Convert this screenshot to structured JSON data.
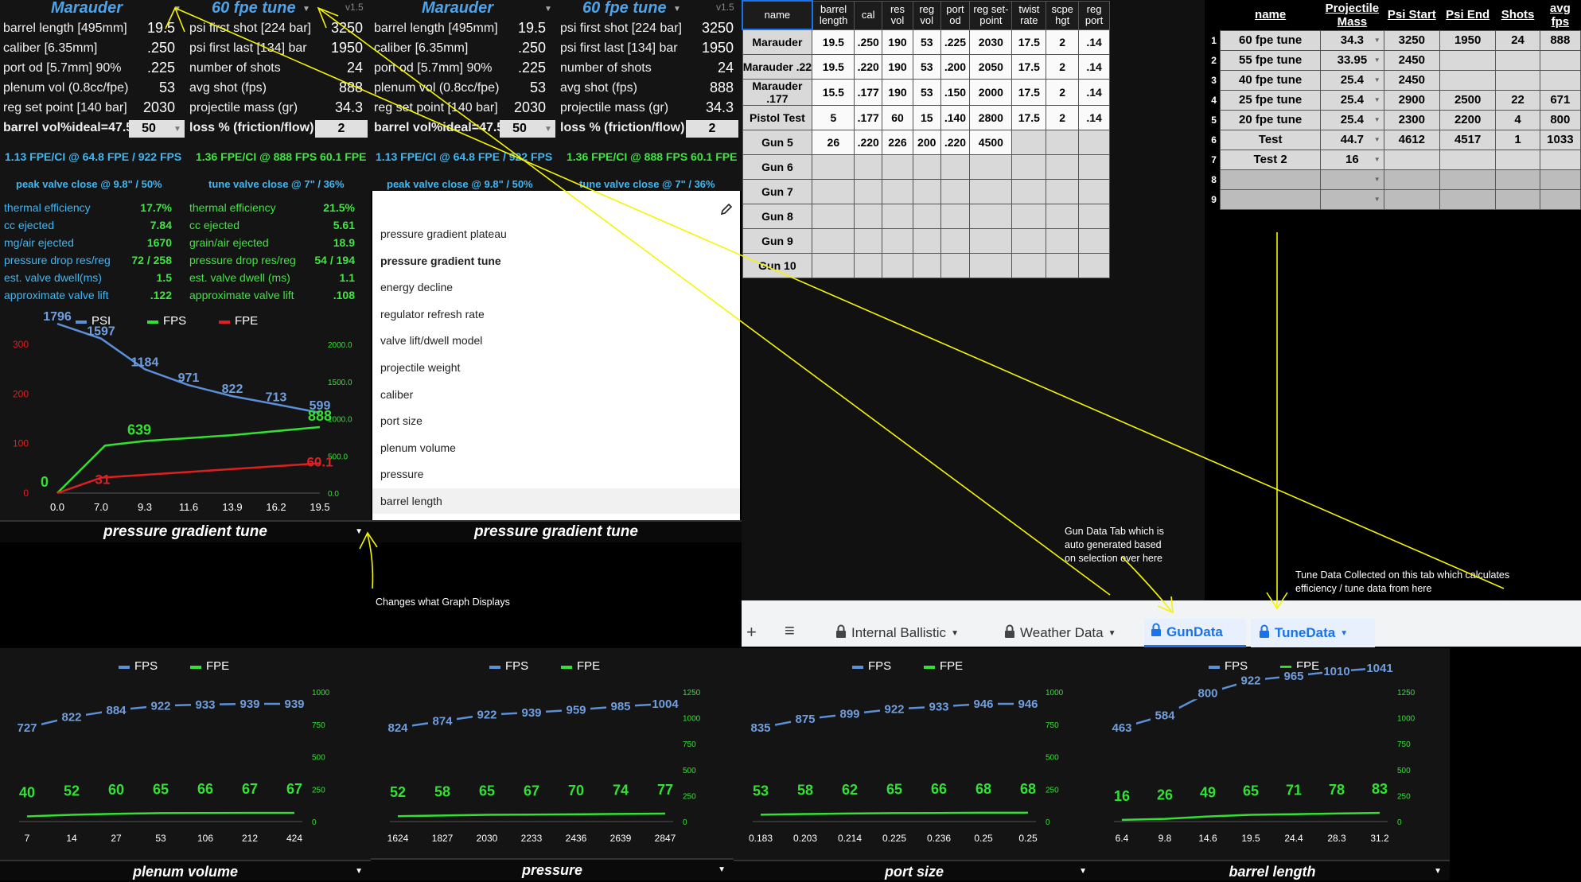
{
  "panels": [
    {
      "name": "Marauder",
      "tune": "60 fpe tune",
      "version": "v1.5",
      "left_labels": [
        "barrel length [495mm]",
        "caliber [6.35mm]",
        "port od [5.7mm] 90%",
        "plenum vol (0.8cc/fpe)",
        "reg set point [140 bar]",
        "barrel vol%ideal=47.5"
      ],
      "left_values": [
        "19.5",
        ".250",
        ".225",
        "53",
        "2030",
        "50"
      ],
      "right_labels": [
        "psi first shot [224 bar]",
        "psi first last [134] bar",
        "number of shots",
        "avg shot (fps)",
        "projectile mass (gr)",
        "loss % (friction/flow)"
      ],
      "right_values": [
        "3250",
        "1950",
        "24",
        "888",
        "34.3",
        "2"
      ],
      "summary_a": "1.13 FPE/CI @ 64.8 FPE / 922 FPS",
      "summary_b": "1.36 FPE/CI @ 888 FPS 60.1 FPE",
      "valve_a": "peak valve close @ 9.8\" / 50%",
      "valve_b": "tune valve close @ 7\" / 36%",
      "footer": "pressure gradient tune"
    },
    {
      "name": "Marauder",
      "tune": "60 fpe tune",
      "version": "v1.5",
      "left_labels": [
        "barrel length [495mm]",
        "caliber [6.35mm]",
        "port od [5.7mm] 90%",
        "plenum vol (0.8cc/fpe)",
        "reg set point [140 bar]",
        "barrel vol%ideal=47.5"
      ],
      "left_values": [
        "19.5",
        ".250",
        ".225",
        "53",
        "2030",
        "50"
      ],
      "right_labels": [
        "psi first shot [224 bar]",
        "psi first last [134] bar",
        "number of shots",
        "avg shot (fps)",
        "projectile mass (gr)",
        "loss % (friction/flow)"
      ],
      "right_values": [
        "3250",
        "1950",
        "24",
        "888",
        "34.3",
        "2"
      ],
      "summary_a": "1.13 FPE/CI @ 64.8 FPE / 922 FPS",
      "summary_b": "1.36 FPE/CI @ 888 FPS 60.1 FPE",
      "valve_a": "peak valve close @ 9.8\" / 50%",
      "valve_b": "tune valve close @ 7\" / 36%",
      "footer": "pressure gradient tune"
    }
  ],
  "stats": {
    "left_labels": [
      "thermal efficiency",
      "cc ejected",
      "mg/air ejected",
      "pressure drop res/reg",
      "est. valve dwell(ms)",
      "approximate valve lift"
    ],
    "left_values": [
      "17.7%",
      "7.84",
      "1670",
      "72 / 258",
      "1.5",
      ".122"
    ],
    "right_labels": [
      "thermal efficiency",
      "cc ejected",
      "grain/air ejected",
      "pressure drop res/reg",
      "est. valve dwell (ms)",
      "approximate valve lift"
    ],
    "right_values": [
      "21.5%",
      "5.61",
      "18.9",
      "54 / 194",
      "1.1",
      ".108"
    ]
  },
  "menu_items": [
    "pressure gradient plateau",
    "pressure gradient tune",
    "energy decline",
    "regulator refresh rate",
    "valve lift/dwell model",
    "projectile weight",
    "caliber",
    "port size",
    "plenum volume",
    "pressure",
    "barrel length"
  ],
  "gun_table": {
    "headers": [
      "name",
      "barrel length",
      "cal",
      "res vol",
      "reg vol",
      "port od",
      "reg set-point",
      "twist rate",
      "scpe hgt",
      "reg port"
    ],
    "rows": [
      [
        "Marauder",
        "19.5",
        ".250",
        "190",
        "53",
        ".225",
        "2030",
        "17.5",
        "2",
        ".14"
      ],
      [
        "Marauder .22",
        "19.5",
        ".220",
        "190",
        "53",
        ".200",
        "2050",
        "17.5",
        "2",
        ".14"
      ],
      [
        "Marauder .177",
        "15.5",
        ".177",
        "190",
        "53",
        ".150",
        "2000",
        "17.5",
        "2",
        ".14"
      ],
      [
        "Pistol Test",
        "5",
        ".177",
        "60",
        "15",
        ".140",
        "2800",
        "17.5",
        "2",
        ".14"
      ],
      [
        "Gun 5",
        "26",
        ".220",
        "226",
        "200",
        ".220",
        "4500",
        "",
        "",
        ""
      ],
      [
        "Gun 6",
        "",
        "",
        "",
        "",
        "",
        "",
        "",
        "",
        ""
      ],
      [
        "Gun 7",
        "",
        "",
        "",
        "",
        "",
        "",
        "",
        "",
        ""
      ],
      [
        "Gun 8",
        "",
        "",
        "",
        "",
        "",
        "",
        "",
        "",
        ""
      ],
      [
        "Gun 9",
        "",
        "",
        "",
        "",
        "",
        "",
        "",
        "",
        ""
      ],
      [
        "Gun 10",
        "",
        "",
        "",
        "",
        "",
        "",
        "",
        "",
        ""
      ]
    ]
  },
  "tune_table": {
    "headers": [
      "name",
      "Projectile Mass",
      "Psi Start",
      "Psi End",
      "Shots",
      "avg fps"
    ],
    "row_numbers": [
      "1",
      "2",
      "3",
      "4",
      "5",
      "6",
      "7",
      "8",
      "9"
    ],
    "rows": [
      [
        "60 fpe tune",
        "34.3",
        "3250",
        "1950",
        "24",
        "888"
      ],
      [
        "55 fpe tune",
        "33.95",
        "2450",
        "",
        "",
        ""
      ],
      [
        "40 fpe tune",
        "25.4",
        "2450",
        "",
        "",
        ""
      ],
      [
        "25 fpe tune",
        "25.4",
        "2900",
        "2500",
        "22",
        "671"
      ],
      [
        "20 fpe tune",
        "25.4",
        "2300",
        "2200",
        "4",
        "800"
      ],
      [
        "Test",
        "44.7",
        "4612",
        "4517",
        "1",
        "1033"
      ],
      [
        "Test 2",
        "16",
        "",
        "",
        "",
        ""
      ],
      [
        "",
        "",
        "",
        "",
        "",
        ""
      ],
      [
        "",
        "",
        "",
        "",
        "",
        ""
      ]
    ]
  },
  "annotations": {
    "graph_note": "Changes what Graph Displays",
    "gun_note": "Gun Data Tab which is auto generated based on selection over here",
    "tune_note": "Tune Data Collected on this tab which calculates efficiency / tune data from here"
  },
  "sheet_tabs": [
    "Internal Ballistic",
    "Weather Data",
    "GunData",
    "TuneData"
  ],
  "sheet_icons": {
    "add": "+",
    "menu": "≡"
  },
  "colors": {
    "blue": "#5b8fd8",
    "green": "#34e034",
    "red": "#e02020",
    "cyan": "#3fb7f5",
    "tab_active": "#1a73e8"
  },
  "chart_data": [
    {
      "type": "line",
      "title": "",
      "legend": [
        "PSI",
        "FPS",
        "FPE"
      ],
      "x": [
        "0.0",
        "7.0",
        "9.3",
        "11.6",
        "13.9",
        "16.2",
        "19.5"
      ],
      "series": [
        {
          "name": "PSI",
          "values": [
            1796,
            1597,
            1184,
            971,
            822,
            713,
            599
          ]
        },
        {
          "name": "FPS",
          "values": [
            0,
            639,
            null,
            null,
            null,
            null,
            888
          ]
        },
        {
          "name": "FPE",
          "values": [
            0,
            31,
            null,
            null,
            null,
            null,
            60.1
          ]
        }
      ],
      "left_axis": [
        0,
        100,
        200,
        300
      ],
      "right_axis": [
        "0.0",
        "500.0",
        "1000.0",
        "1500.0",
        "2000.0"
      ],
      "footer": "pressure gradient tune"
    },
    {
      "type": "line",
      "legend": [
        "FPS",
        "FPE"
      ],
      "x": [
        "7",
        "14",
        "27",
        "53",
        "106",
        "212",
        "424"
      ],
      "series": [
        {
          "name": "FPS",
          "values": [
            727,
            822,
            884,
            922,
            933,
            939,
            939
          ]
        },
        {
          "name": "FPE",
          "values": [
            40,
            52,
            60,
            65,
            66,
            67,
            67
          ]
        }
      ],
      "right_axis": [
        "0",
        "250",
        "500",
        "750",
        "1000"
      ],
      "footer": "plenum volume"
    },
    {
      "type": "line",
      "legend": [
        "FPS",
        "FPE"
      ],
      "x": [
        "1624",
        "1827",
        "2030",
        "2233",
        "2436",
        "2639",
        "2847"
      ],
      "series": [
        {
          "name": "FPS",
          "values": [
            824,
            874,
            922,
            939,
            959,
            985,
            1004
          ]
        },
        {
          "name": "FPE",
          "values": [
            52,
            58,
            65,
            67,
            70,
            74,
            77
          ]
        }
      ],
      "right_axis": [
        "0",
        "250",
        "500",
        "750",
        "1000",
        "1250"
      ],
      "footer": "pressure"
    },
    {
      "type": "line",
      "legend": [
        "FPS",
        "FPE"
      ],
      "x": [
        "0.183",
        "0.203",
        "0.214",
        "0.225",
        "0.236",
        "0.25",
        "0.25"
      ],
      "series": [
        {
          "name": "FPS",
          "values": [
            835,
            875,
            899,
            922,
            933,
            946,
            946
          ]
        },
        {
          "name": "FPE",
          "values": [
            53,
            58,
            62,
            65,
            66,
            68,
            68
          ]
        }
      ],
      "right_axis": [
        "0",
        "250",
        "500",
        "750",
        "1000"
      ],
      "footer": "port size"
    },
    {
      "type": "line",
      "legend": [
        "FPS",
        "FPE"
      ],
      "x": [
        "6.4",
        "9.8",
        "14.6",
        "19.5",
        "24.4",
        "28.3",
        "31.2"
      ],
      "series": [
        {
          "name": "FPS",
          "values": [
            463,
            584,
            800,
            922,
            965,
            1010,
            1041
          ]
        },
        {
          "name": "FPE",
          "values": [
            16,
            26,
            49,
            65,
            71,
            78,
            83
          ]
        }
      ],
      "right_axis": [
        "0",
        "250",
        "500",
        "750",
        "1000",
        "1250"
      ],
      "footer": "barrel length"
    }
  ]
}
